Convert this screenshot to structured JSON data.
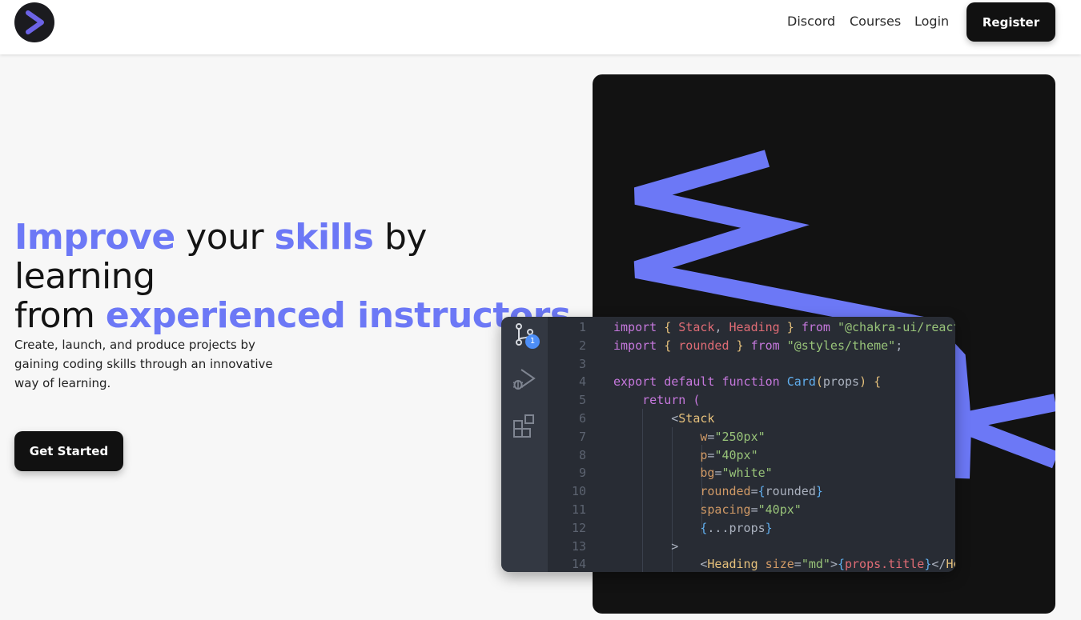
{
  "nav": {
    "links": [
      "Discord",
      "Courses",
      "Login"
    ],
    "register_label": "Register"
  },
  "hero": {
    "title_parts": [
      "Improve",
      " your ",
      "skills",
      " by learning",
      "from ",
      "experienced instructors"
    ],
    "subtitle": "Create, launch, and produce projects by gaining coding skills through an innovative way of learning.",
    "cta_label": "Get Started"
  },
  "editor": {
    "badge_count": "1",
    "line_numbers": [
      "1",
      "2",
      "3",
      "4",
      "5",
      "6",
      "7",
      "8",
      "9",
      "10",
      "11",
      "12",
      "13",
      "14"
    ],
    "lines": [
      [
        [
          "kw",
          "import"
        ],
        [
          "pl",
          " "
        ],
        [
          "brace",
          "{"
        ],
        [
          "pl",
          " "
        ],
        [
          "var",
          "Stack"
        ],
        [
          "pl",
          ", "
        ],
        [
          "var",
          "Heading"
        ],
        [
          "pl",
          " "
        ],
        [
          "brace",
          "}"
        ],
        [
          "pl",
          " "
        ],
        [
          "kw",
          "from"
        ],
        [
          "pl",
          " "
        ],
        [
          "str",
          "\"@chakra-ui/react\";"
        ]
      ],
      [
        [
          "kw",
          "import"
        ],
        [
          "pl",
          " "
        ],
        [
          "brace",
          "{"
        ],
        [
          "pl",
          " "
        ],
        [
          "var",
          "rounded"
        ],
        [
          "pl",
          " "
        ],
        [
          "brace",
          "}"
        ],
        [
          "pl",
          " "
        ],
        [
          "kw",
          "from"
        ],
        [
          "pl",
          " "
        ],
        [
          "str",
          "\"@styles/theme\""
        ],
        [
          "pl",
          ";"
        ]
      ],
      [],
      [
        [
          "kw",
          "export"
        ],
        [
          "pl",
          " "
        ],
        [
          "kw",
          "default"
        ],
        [
          "pl",
          " "
        ],
        [
          "kw",
          "function"
        ],
        [
          "pl",
          " "
        ],
        [
          "fn",
          "Card"
        ],
        [
          "brace",
          "("
        ],
        [
          "pl",
          "props"
        ],
        [
          "brace",
          ")"
        ],
        [
          "pl",
          " "
        ],
        [
          "brace",
          "{"
        ]
      ],
      [
        [
          "pl",
          "    "
        ],
        [
          "kw",
          "return"
        ],
        [
          "pl",
          " "
        ],
        [
          "br2",
          "("
        ]
      ],
      [
        [
          "pl",
          "        "
        ],
        [
          "pl",
          "<"
        ],
        [
          "tag",
          "Stack"
        ]
      ],
      [
        [
          "pl",
          "            "
        ],
        [
          "attr",
          "w"
        ],
        [
          "pl",
          "="
        ],
        [
          "str",
          "\"250px\""
        ]
      ],
      [
        [
          "pl",
          "            "
        ],
        [
          "attr",
          "p"
        ],
        [
          "pl",
          "="
        ],
        [
          "str",
          "\"40px\""
        ]
      ],
      [
        [
          "pl",
          "            "
        ],
        [
          "attr",
          "bg"
        ],
        [
          "pl",
          "="
        ],
        [
          "str",
          "\"white\""
        ]
      ],
      [
        [
          "pl",
          "            "
        ],
        [
          "attr",
          "rounded"
        ],
        [
          "pl",
          "="
        ],
        [
          "fn",
          "{"
        ],
        [
          "pl",
          "rounded"
        ],
        [
          "fn",
          "}"
        ]
      ],
      [
        [
          "pl",
          "            "
        ],
        [
          "attr",
          "spacing"
        ],
        [
          "pl",
          "="
        ],
        [
          "str",
          "\"40px\""
        ]
      ],
      [
        [
          "pl",
          "            "
        ],
        [
          "fn",
          "{"
        ],
        [
          "pl",
          "...props"
        ],
        [
          "fn",
          "}"
        ]
      ],
      [
        [
          "pl",
          "        "
        ],
        [
          "pl",
          ">"
        ]
      ],
      [
        [
          "pl",
          "            "
        ],
        [
          "pl",
          "<"
        ],
        [
          "tag",
          "Heading"
        ],
        [
          "pl",
          " "
        ],
        [
          "attr",
          "size"
        ],
        [
          "pl",
          "="
        ],
        [
          "str",
          "\"md\""
        ],
        [
          "pl",
          ">"
        ],
        [
          "fn",
          "{"
        ],
        [
          "var",
          "props.title"
        ],
        [
          "fn",
          "}"
        ],
        [
          "pl",
          "</"
        ],
        [
          "tag",
          "Heading"
        ],
        [
          "pl",
          ">"
        ]
      ]
    ]
  },
  "icons": [
    "logo-chevron-icon",
    "source-control-icon",
    "run-debug-icon",
    "extensions-icon"
  ],
  "colors": {
    "accent": "#6c78f6",
    "dark": "#111111",
    "panel": "#121212",
    "editor_bg": "#282c34"
  }
}
